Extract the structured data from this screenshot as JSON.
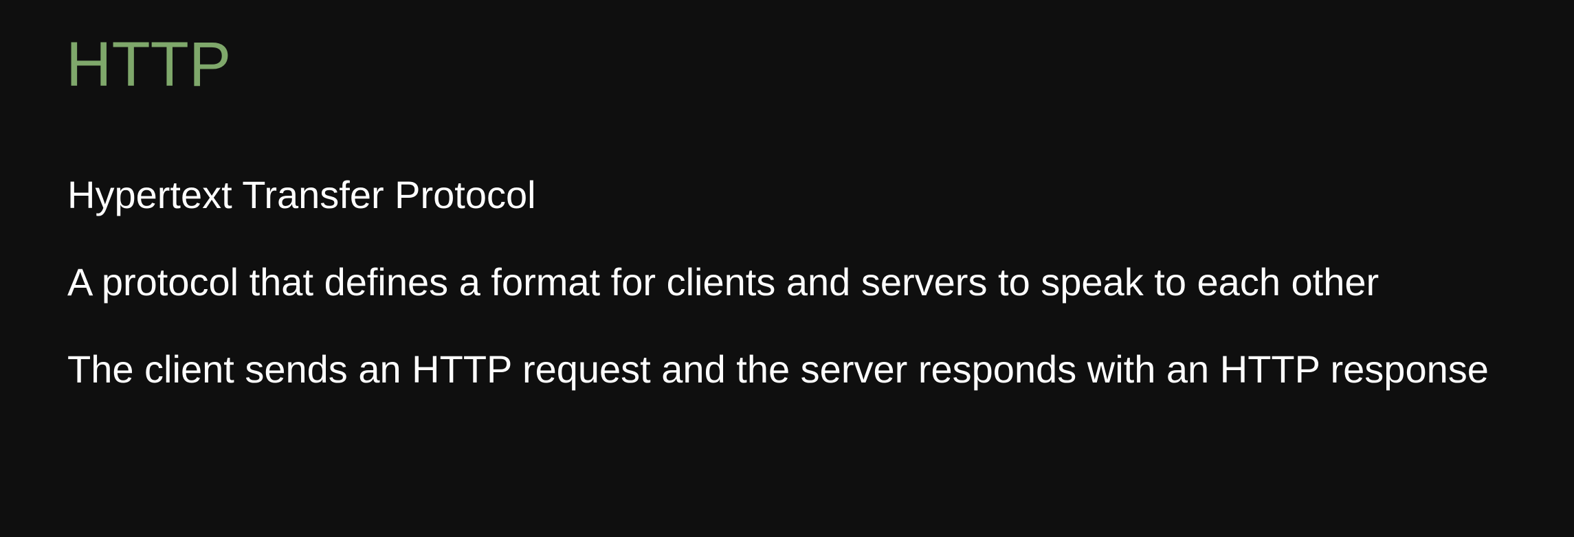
{
  "slide": {
    "title": "HTTP",
    "title_color": "#7fa86b",
    "background_color": "#0f0f0f",
    "text_color": "#ffffff",
    "points": [
      "Hypertext Transfer Protocol",
      "A protocol that defines a format for clients and servers to speak to each other",
      "The client sends an HTTP request and the server responds with an HTTP response"
    ]
  }
}
